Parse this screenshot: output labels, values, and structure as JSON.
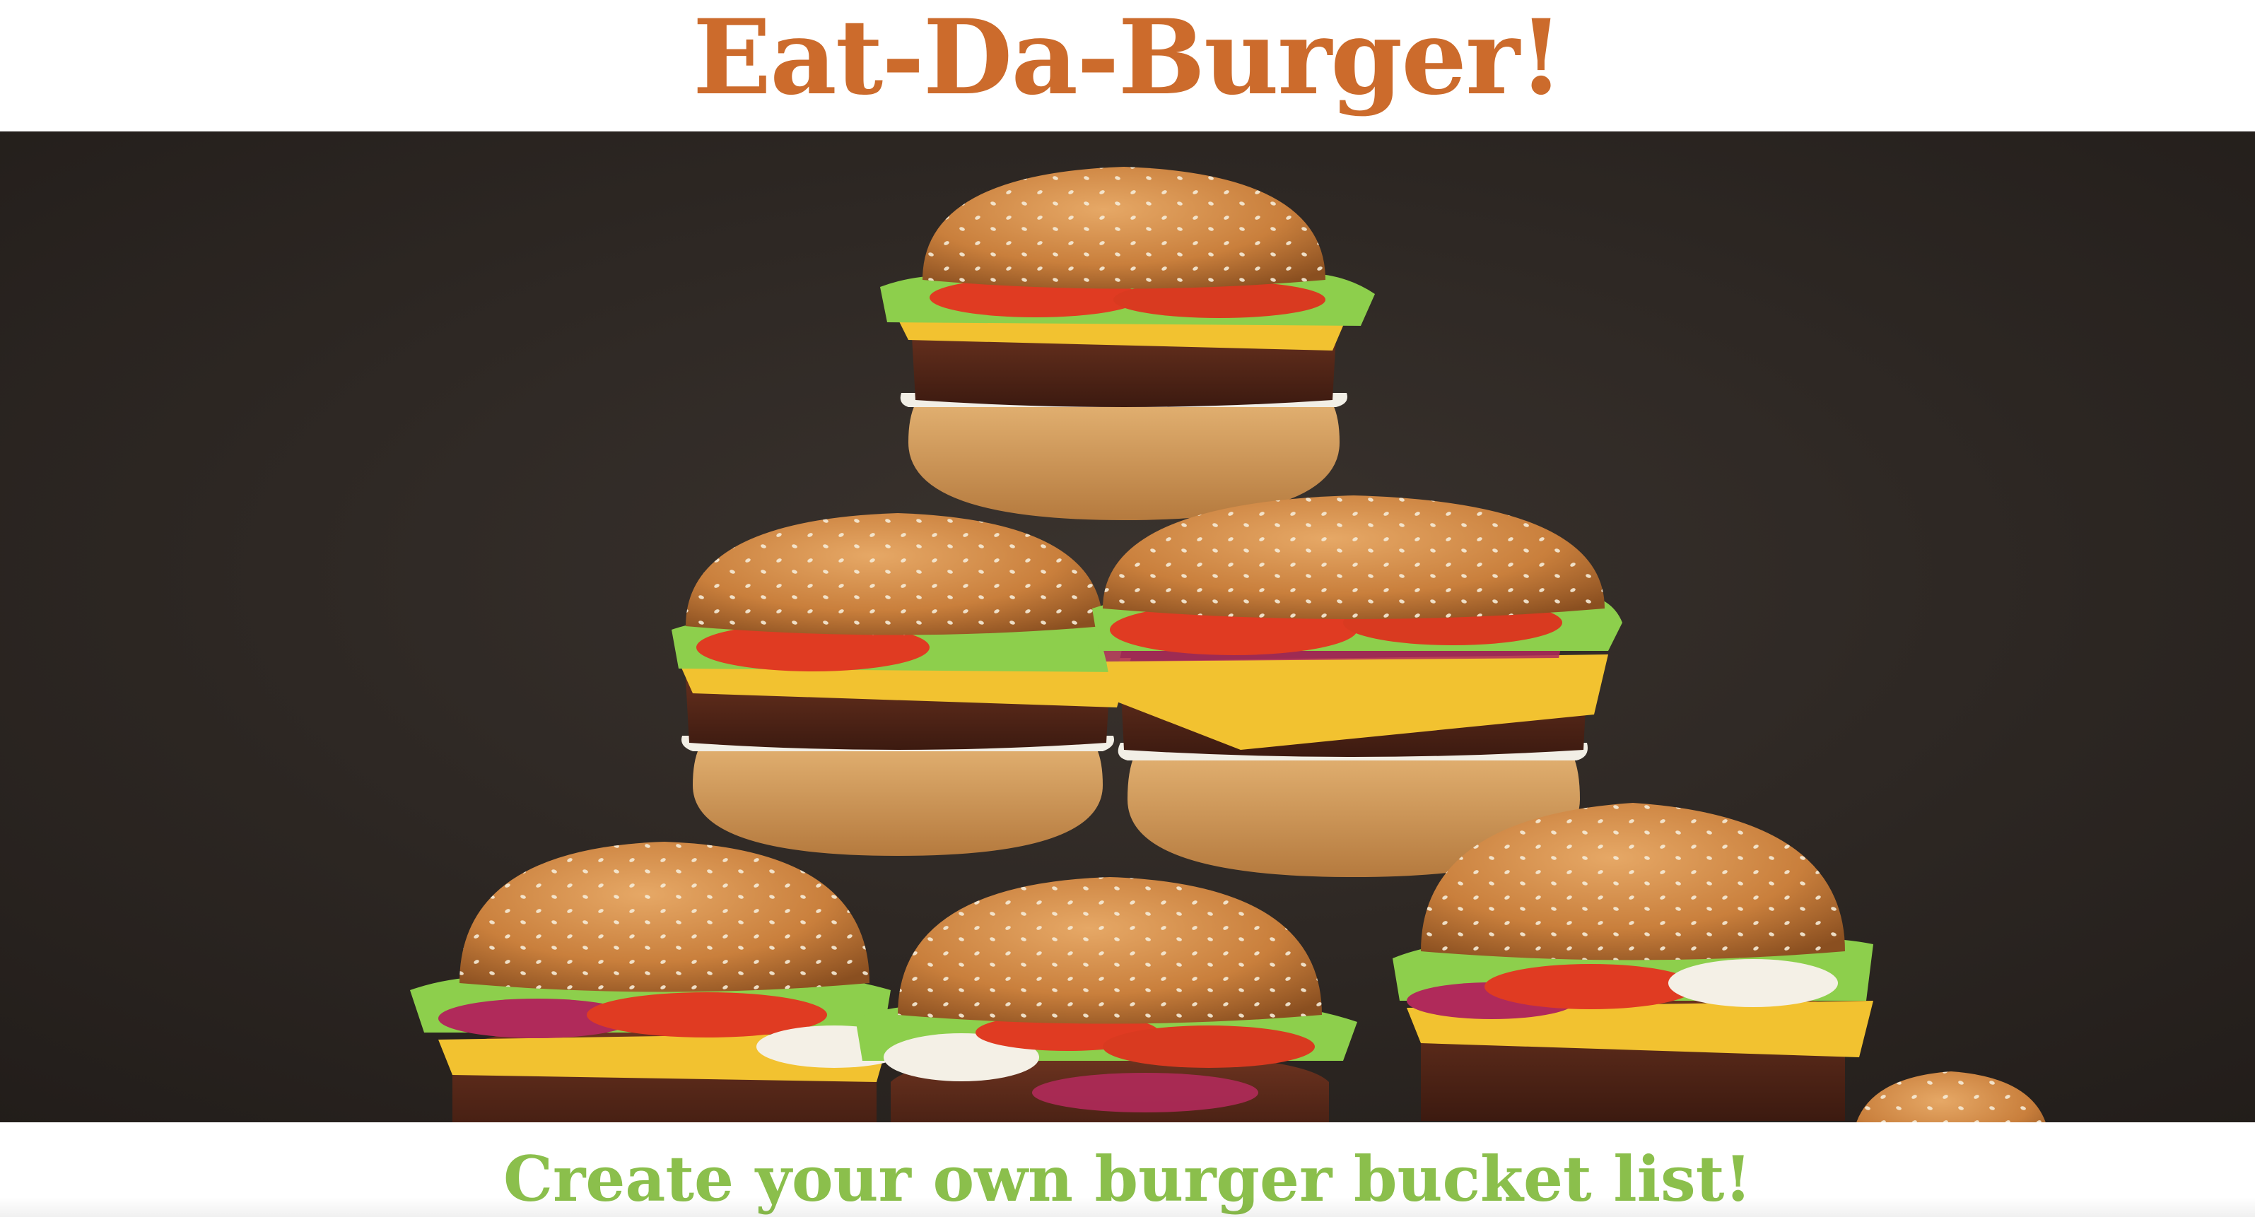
{
  "header": {
    "title": "Eat-Da-Burger!",
    "title_color": "#cc6b2c"
  },
  "hero": {
    "image_subject": "stack-of-cheeseburgers",
    "background_color": "#2e2825"
  },
  "tagline": {
    "text": "Create your own burger bucket list!",
    "color": "#8bbf4c"
  }
}
